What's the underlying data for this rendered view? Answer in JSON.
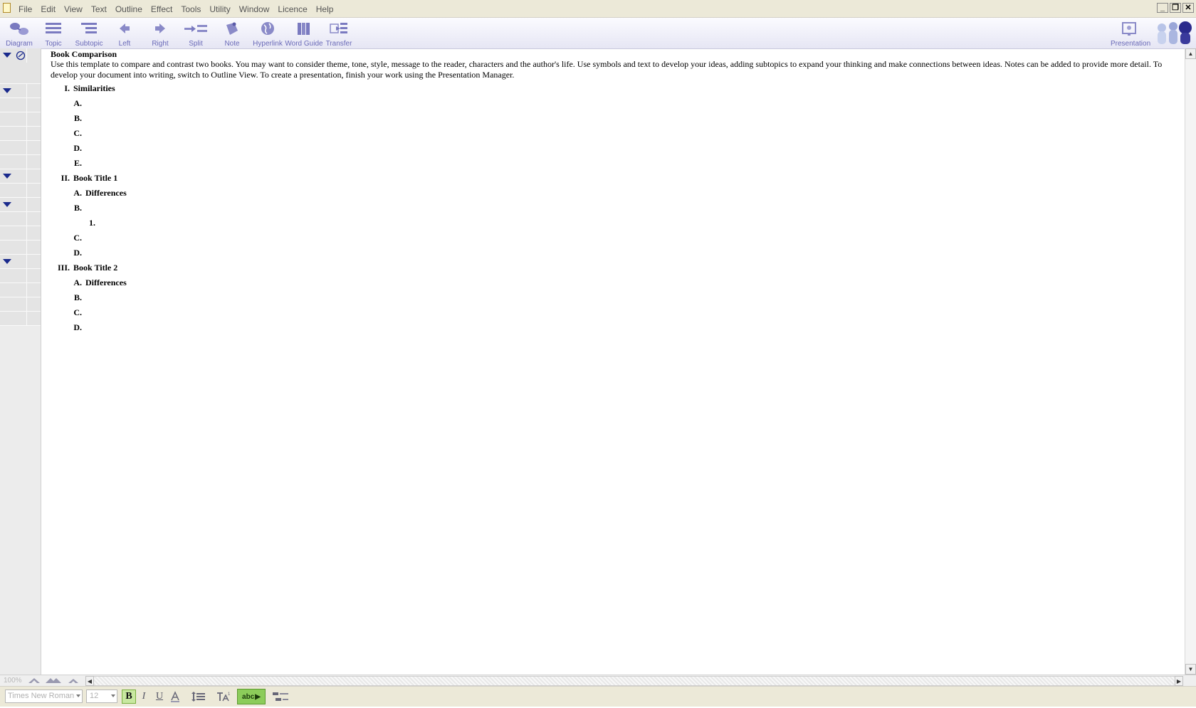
{
  "menubar": {
    "items": [
      "File",
      "Edit",
      "View",
      "Text",
      "Outline",
      "Effect",
      "Tools",
      "Utility",
      "Window",
      "Licence",
      "Help"
    ]
  },
  "toolbar": {
    "diagram": "Diagram",
    "topic": "Topic",
    "subtopic": "Subtopic",
    "left": "Left",
    "right": "Right",
    "split": "Split",
    "note": "Note",
    "hyperlink": "Hyperlink",
    "word_guide": "Word Guide",
    "transfer": "Transfer",
    "presentation": "Presentation"
  },
  "document": {
    "title": "Book Comparison",
    "note": "Use this template to compare and contrast two books. You may want to consider theme, tone, style, message to the reader, characters and the author's life. Use symbols and text to develop your ideas, adding subtopics to expand your thinking and make connections between ideas. Notes can be added to provide more detail. To develop your document into writing, switch to Outline View. To create a presentation, finish your work using the Presentation Manager."
  },
  "outline": [
    {
      "num": "I.",
      "text": "Similarities",
      "level": 1,
      "collapsible": true
    },
    {
      "num": "A.",
      "text": "",
      "level": 2,
      "collapsible": false
    },
    {
      "num": "B.",
      "text": "",
      "level": 2,
      "collapsible": false
    },
    {
      "num": "C.",
      "text": "",
      "level": 2,
      "collapsible": false
    },
    {
      "num": "D.",
      "text": "",
      "level": 2,
      "collapsible": false
    },
    {
      "num": "E.",
      "text": "",
      "level": 2,
      "collapsible": false
    },
    {
      "num": "II.",
      "text": "Book Title 1",
      "level": 1,
      "collapsible": true
    },
    {
      "num": "A.",
      "text": "Differences",
      "level": 2,
      "collapsible": false
    },
    {
      "num": "B.",
      "text": "",
      "level": 2,
      "collapsible": true
    },
    {
      "num": "1.",
      "text": "",
      "level": 3,
      "collapsible": false
    },
    {
      "num": "C.",
      "text": "",
      "level": 2,
      "collapsible": false
    },
    {
      "num": "D.",
      "text": "",
      "level": 2,
      "collapsible": false
    },
    {
      "num": "III.",
      "text": "Book Title 2",
      "level": 1,
      "collapsible": true
    },
    {
      "num": "A.",
      "text": "Differences",
      "level": 2,
      "collapsible": false
    },
    {
      "num": "B.",
      "text": "",
      "level": 2,
      "collapsible": false
    },
    {
      "num": "C.",
      "text": "",
      "level": 2,
      "collapsible": false
    },
    {
      "num": "D.",
      "text": "",
      "level": 2,
      "collapsible": false
    }
  ],
  "status": {
    "zoom": "100%"
  },
  "formatbar": {
    "font": "Times New Roman",
    "size": "12",
    "bold": "B",
    "italic": "I",
    "underline": "U",
    "spell": "abc"
  },
  "colors": {
    "accent": "#6a6ab8",
    "triangle": "#1a2a8c",
    "spell_green": "#8ccc5a"
  }
}
